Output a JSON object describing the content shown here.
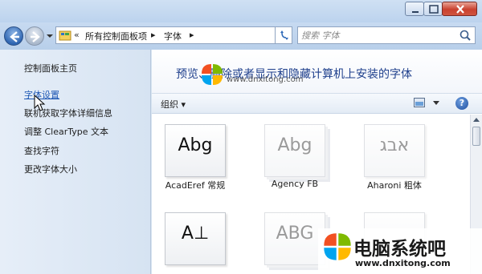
{
  "window": {
    "controls": [
      "minimize",
      "maximize",
      "close"
    ]
  },
  "navigation": {
    "back_icon": "back-arrow-icon",
    "forward_icon": "forward-arrow-icon",
    "breadcrumb": {
      "overflow": "«",
      "items": [
        "所有控制面板项",
        "字体"
      ],
      "separator": "▸"
    },
    "refresh_symbol": "↻"
  },
  "search": {
    "placeholder": "搜索 字体"
  },
  "sidebar": {
    "items": [
      {
        "label": "控制面板主页",
        "active": false
      },
      {
        "label": "字体设置",
        "active": true
      },
      {
        "label": "联机获取字体详细信息",
        "active": false
      },
      {
        "label": "调整 ClearType 文本",
        "active": false
      },
      {
        "label": "查找字符",
        "active": false
      },
      {
        "label": "更改字体大小",
        "active": false
      }
    ]
  },
  "main": {
    "title": "预览、删除或者显示和隐藏计算机上安装的字体",
    "toolbar": {
      "organize_label": "组织 ▾",
      "help_label": "?"
    },
    "fonts": [
      {
        "sample": "Abg",
        "name": "AcadEref 常规",
        "faded": false,
        "stacked": false
      },
      {
        "sample": "Abg",
        "name": "Agency FB",
        "faded": true,
        "stacked": true
      },
      {
        "sample": "אבג",
        "name": "Aharoni 粗体",
        "faded": true,
        "stacked": false
      },
      {
        "sample": "A⊥",
        "name": "",
        "faded": false,
        "stacked": false
      },
      {
        "sample": "ABG",
        "name": "",
        "faded": true,
        "stacked": true
      },
      {
        "sample": "",
        "name": "",
        "faded": true,
        "stacked": false
      }
    ]
  },
  "watermark": {
    "url": "www.dnxitong.com",
    "brand": "电脑系统吧",
    "colors": {
      "red": "#f25022",
      "green": "#7fba00",
      "blue": "#00a4ef",
      "yellow": "#ffb900"
    }
  }
}
